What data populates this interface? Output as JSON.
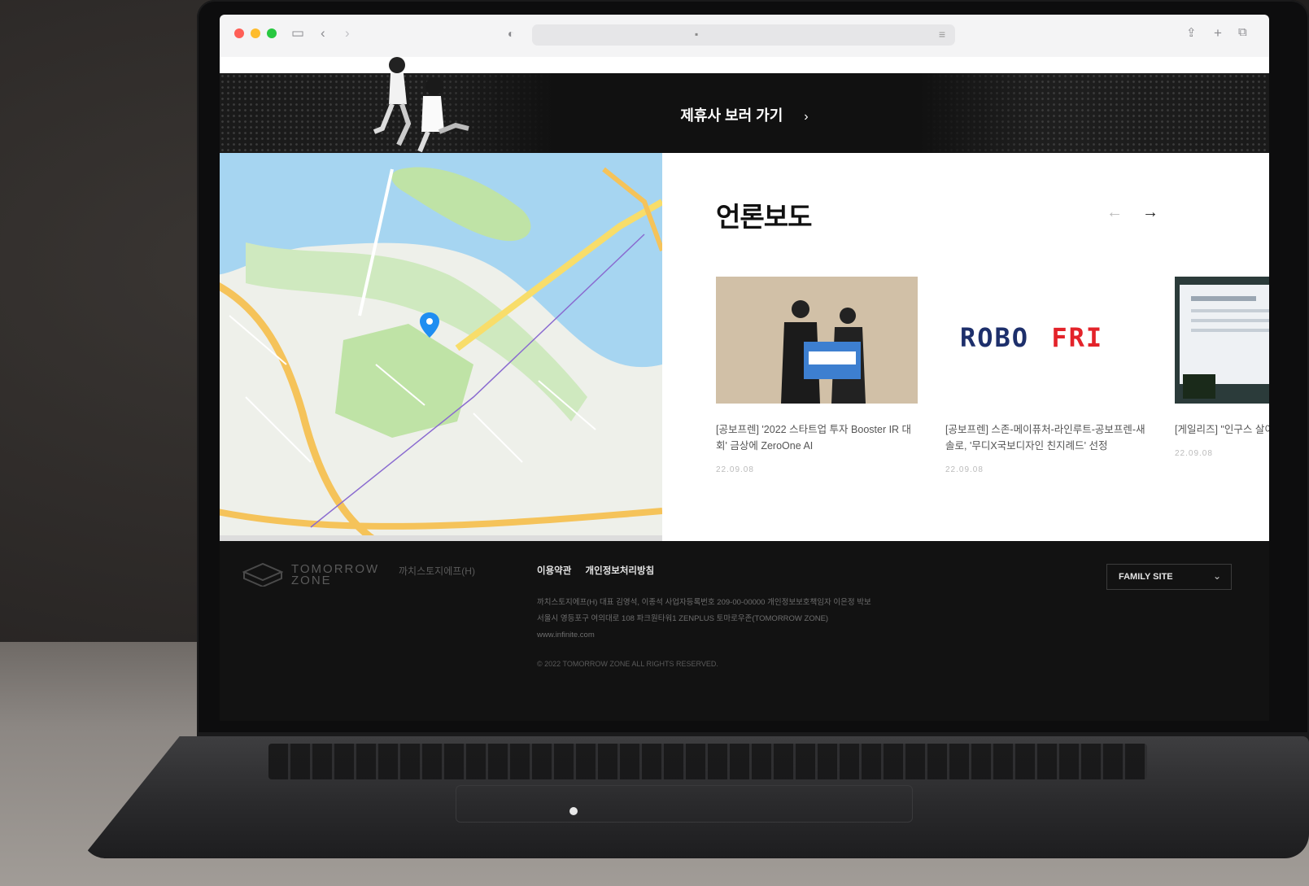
{
  "browser": {
    "traffic_light_colors": [
      "#ff5f57",
      "#febc2e",
      "#28c840"
    ],
    "icons": [
      "sidebar-icon",
      "back-icon",
      "forward-icon",
      "privacy-shield-icon",
      "lock-icon",
      "share-icon",
      "new-tab-icon",
      "tabs-icon"
    ]
  },
  "banner": {
    "link_label": "제휴사 보러 가기",
    "arrow": "›"
  },
  "press": {
    "title": "언론보도",
    "prev_arrow": "←",
    "next_arrow": "→",
    "cards": [
      {
        "title": "[공보프렌] '2022 스타트업 투자 Booster IR 대회' 금상에 ZeroOne AI",
        "date": "22.09.08"
      },
      {
        "logo_text_1": "ROBO",
        "logo_text_2": "FRI",
        "title": "[공보프렌] 스존-메이퓨처-라인루트-공보프렌-새솔로, '무디X국보디자인 친지례드' 선정",
        "date": "22.09.08"
      },
      {
        "title": "[게일리즈] \"인구스 살이다\"...스타트업",
        "date": "22.09.08"
      }
    ]
  },
  "footer": {
    "logo_text": "TOMORROW ZONE",
    "org_name": "까치스토지에프(H)",
    "links": [
      "이용약관",
      "개인정보처리방침"
    ],
    "info_lines": [
      "까치스토지에프(H)  대표 김영석, 이종석  사업자등록번호 209-00-00000  개인정보보호책임자 이은정 박보",
      "서울시 영등포구 여의대로 108 파크원타워1 ZENPLUS 토마로우존(TOMORROW ZONE)",
      "www.infinite.com"
    ],
    "copyright": "© 2022 TOMORROW ZONE ALL RIGHTS RESERVED.",
    "family_site_label": "FAMILY SITE",
    "family_site_chevron": "⌄"
  },
  "colors": {
    "accent_red": "#e3232a",
    "robo_navy": "#1d2f6b",
    "map_water": "#a6d5f1",
    "map_park": "#bfe3a6",
    "map_road": "#f5c35a"
  }
}
